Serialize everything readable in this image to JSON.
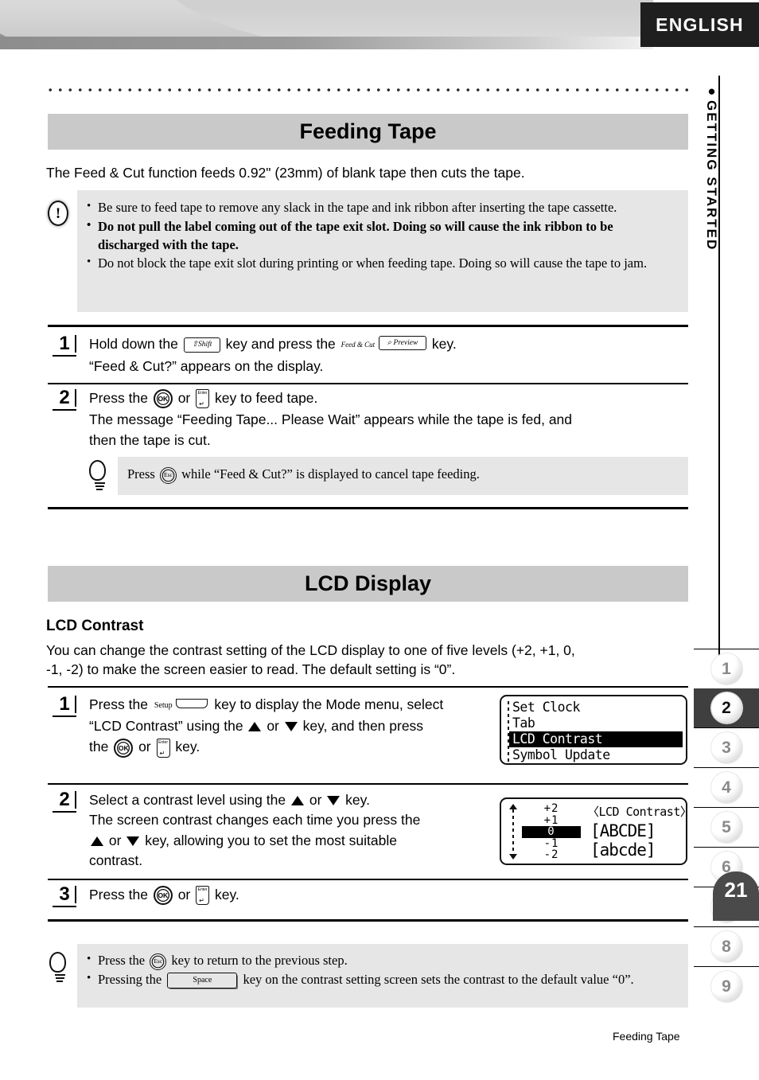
{
  "header": {
    "language_badge": "ENGLISH"
  },
  "side_rail": {
    "section_label": "GETTING STARTED",
    "bullet": "●",
    "tabs": [
      "1",
      "2",
      "3",
      "4",
      "5",
      "6",
      "7",
      "8",
      "9"
    ],
    "active_tab": "2",
    "page_number": "21"
  },
  "footer": {
    "running_title": "Feeding Tape"
  },
  "sections": [
    {
      "band_title": "Feeding Tape",
      "intro": "The Feed & Cut function feeds 0.92\" (23mm) of blank tape then cuts the tape.",
      "caution": {
        "icon": "exclamation-icon",
        "items": [
          {
            "text": "Be sure to feed tape to remove any slack in the tape and ink ribbon after inserting the tape cassette.",
            "bold": false
          },
          {
            "text": "Do not pull the label coming out of the tape exit slot. Doing so will cause the ink ribbon to be discharged with the tape.",
            "bold": true
          },
          {
            "text": "Do not block the tape exit slot during printing or when feeding tape. Doing so will cause the tape to jam.",
            "bold": false
          }
        ]
      },
      "steps": [
        {
          "number": "1",
          "line1_a": "Hold down the",
          "line1_b": "key and press the",
          "line1_c": "key.",
          "line2": "“Feed & Cut?” appears on the display.",
          "keys": {
            "shift": "⇧Shift",
            "preview_top": "Feed & Cut",
            "preview": "⌕ Preview"
          }
        },
        {
          "number": "2",
          "line1_a": "Press the",
          "line1_b": "or",
          "line1_c": "key to feed tape.",
          "line2": "The message “Feeding Tape... Please Wait” appears while the tape is fed, and",
          "line3": "then the tape is cut.",
          "keys": {
            "ok": "OK",
            "enter_top": "Enter",
            "enter_ret": "↵"
          }
        }
      ],
      "tip": {
        "icon": "lightbulb-icon",
        "text_a": "Press",
        "key_esc": "Esc",
        "text_b": "while “Feed & Cut?” is displayed to cancel tape feeding."
      }
    },
    {
      "band_title": "LCD Display",
      "subheading": "LCD Contrast",
      "intro_line1": "You can change the contrast setting of the LCD display to one of five levels (+2, +1, 0,",
      "intro_line2": "-1, -2) to make the screen easier to read. The default setting is “0”.",
      "steps": [
        {
          "number": "1",
          "line1_a": "Press the",
          "line1_b": "key to display the Mode menu, select",
          "line2_a": "“LCD Contrast” using the",
          "line2_b": "or",
          "line2_c": "key, and then press",
          "line3_a": "the",
          "line3_b": "or",
          "line3_c": "key.",
          "keys": {
            "setup_top": "Setup",
            "ok": "OK",
            "enter_top": "Enter",
            "enter_ret": "↵"
          }
        },
        {
          "number": "2",
          "line1_a": "Select a contrast level using the",
          "line1_b": "or",
          "line1_c": "key.",
          "line2": "The screen contrast changes each time you press the",
          "line3_a": "or",
          "line3_b": "key, allowing you to set the most suitable",
          "line4": "contrast."
        },
        {
          "number": "3",
          "line1_a": "Press the",
          "line1_b": "or",
          "line1_c": "key.",
          "keys": {
            "ok": "OK",
            "enter_top": "Enter",
            "enter_ret": "↵"
          }
        }
      ],
      "tip": {
        "icon": "lightbulb-icon",
        "items": [
          {
            "text_a": "Press the",
            "key": "Esc",
            "text_b": "key to return to the previous step."
          },
          {
            "text_a": "Pressing the",
            "key": "Space",
            "text_b": "key on the contrast setting screen sets the contrast to the default value",
            "text_c": "“0”."
          }
        ]
      },
      "lcd_menu": {
        "rows": [
          "Set Clock",
          "Tab",
          "LCD Contrast",
          "Symbol Update"
        ],
        "selected_index": 2
      },
      "lcd_contrast": {
        "title": "〈LCD Contrast〉",
        "levels": [
          "+2",
          "+1",
          "0",
          "-1",
          "-2"
        ],
        "selected_level": "0",
        "preview_line1": "[ABCDE]",
        "preview_line2": "[abcde]"
      }
    }
  ]
}
